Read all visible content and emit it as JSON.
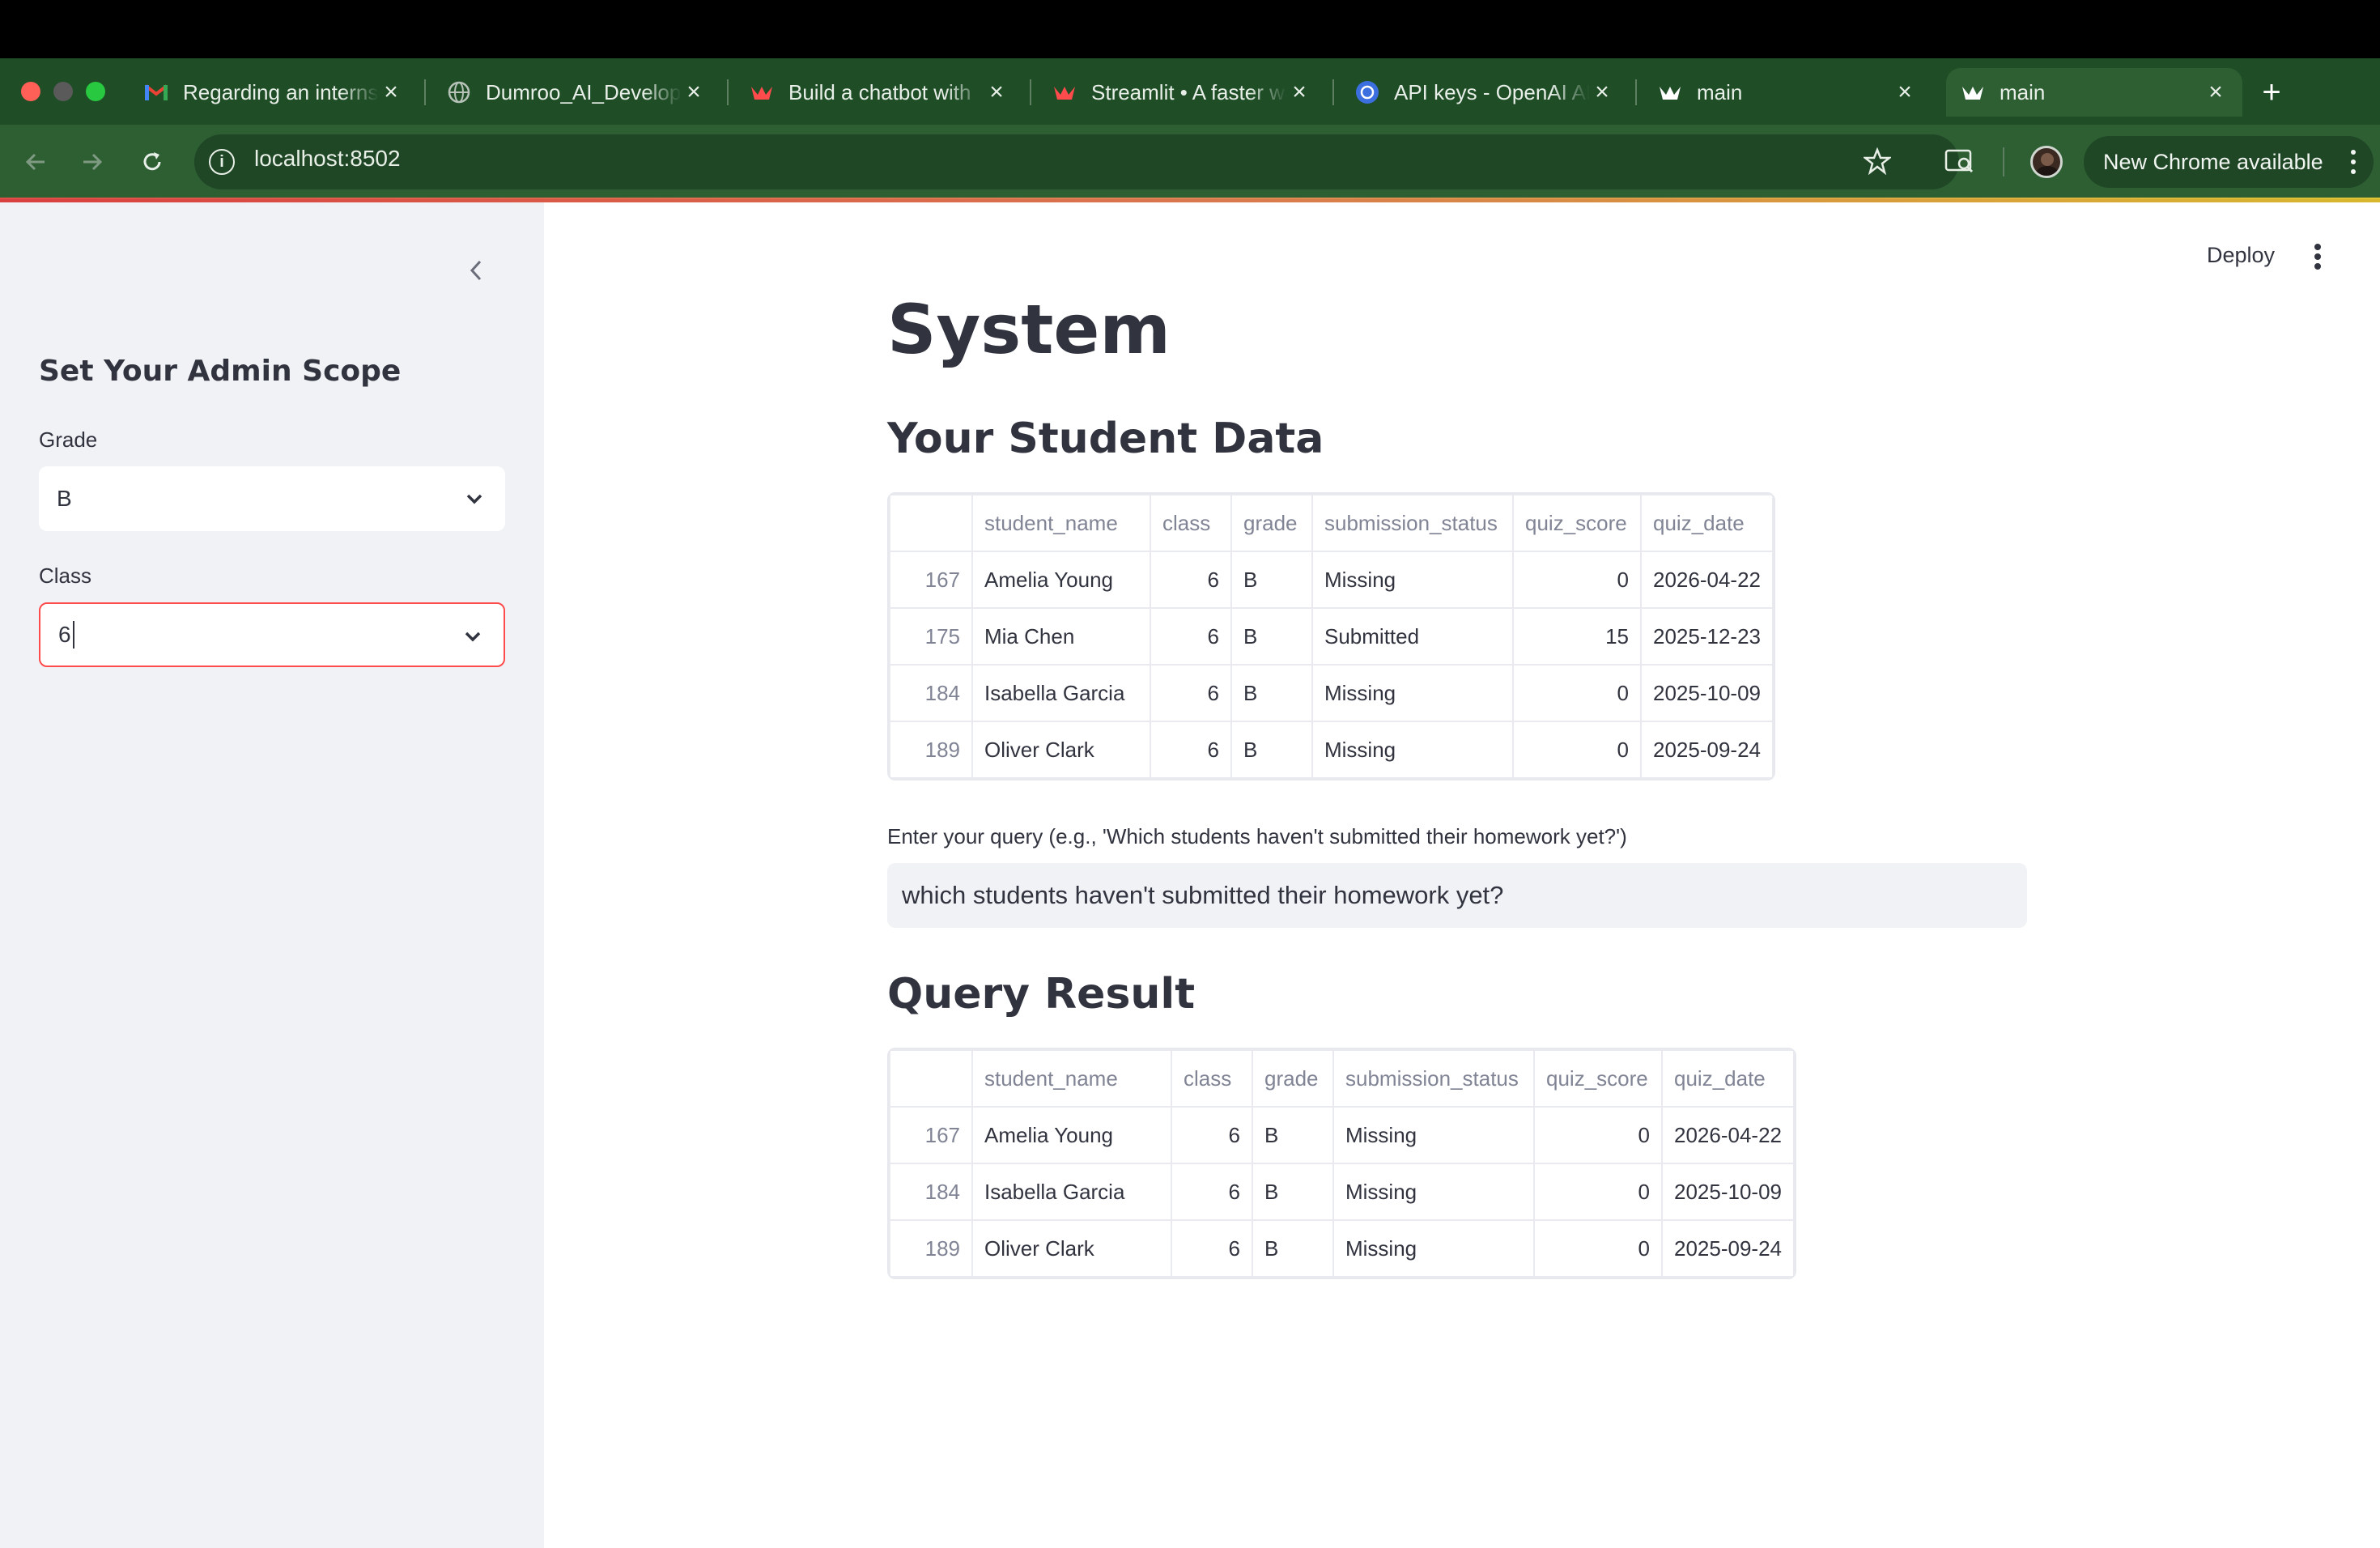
{
  "browser": {
    "tabs": [
      {
        "title": "Regarding an internship",
        "icon": "gmail-icon"
      },
      {
        "title": "Dumroo_AI_Developer",
        "icon": "globe-icon"
      },
      {
        "title": "Build a chatbot with",
        "icon": "streamlit-icon"
      },
      {
        "title": "Streamlit • A faster way",
        "icon": "streamlit-icon"
      },
      {
        "title": "API keys - OpenAI API",
        "icon": "openai-icon"
      },
      {
        "title": "main",
        "icon": "streamlit-icon"
      },
      {
        "title": "main",
        "icon": "streamlit-icon",
        "active": true
      }
    ],
    "url": "localhost:8502",
    "chrome_update_label": "New Chrome available"
  },
  "header": {
    "deploy_label": "Deploy"
  },
  "sidebar": {
    "heading": "Set Your Admin Scope",
    "grade_label": "Grade",
    "grade_value": "B",
    "class_label": "Class",
    "class_value": "6"
  },
  "main": {
    "title": "System",
    "student_data_heading": "Your Student Data",
    "query_label": "Enter your query (e.g., 'Which students haven't submitted their homework yet?')",
    "query_value": "which students haven't submitted their homework yet?",
    "query_result_heading": "Query Result"
  },
  "tables": {
    "columns": [
      "",
      "student_name",
      "class",
      "grade",
      "submission_status",
      "quiz_score",
      "quiz_date"
    ],
    "student_data": [
      [
        "167",
        "Amelia Young",
        "6",
        "B",
        "Missing",
        "0",
        "2026-04-22"
      ],
      [
        "175",
        "Mia Chen",
        "6",
        "B",
        "Submitted",
        "15",
        "2025-12-23"
      ],
      [
        "184",
        "Isabella Garcia",
        "6",
        "B",
        "Missing",
        "0",
        "2025-10-09"
      ],
      [
        "189",
        "Oliver Clark",
        "6",
        "B",
        "Missing",
        "0",
        "2025-09-24"
      ]
    ],
    "query_result": [
      [
        "167",
        "Amelia Young",
        "6",
        "B",
        "Missing",
        "0",
        "2026-04-22"
      ],
      [
        "184",
        "Isabella Garcia",
        "6",
        "B",
        "Missing",
        "0",
        "2025-10-09"
      ],
      [
        "189",
        "Oliver Clark",
        "6",
        "B",
        "Missing",
        "0",
        "2025-09-24"
      ]
    ]
  },
  "colors": {
    "tabstrip": "#1e4d26",
    "toolbar": "#2d5f33",
    "sidebar_bg": "#f0f2f6",
    "focus_border": "#ff4b4b",
    "text": "#31333f"
  }
}
